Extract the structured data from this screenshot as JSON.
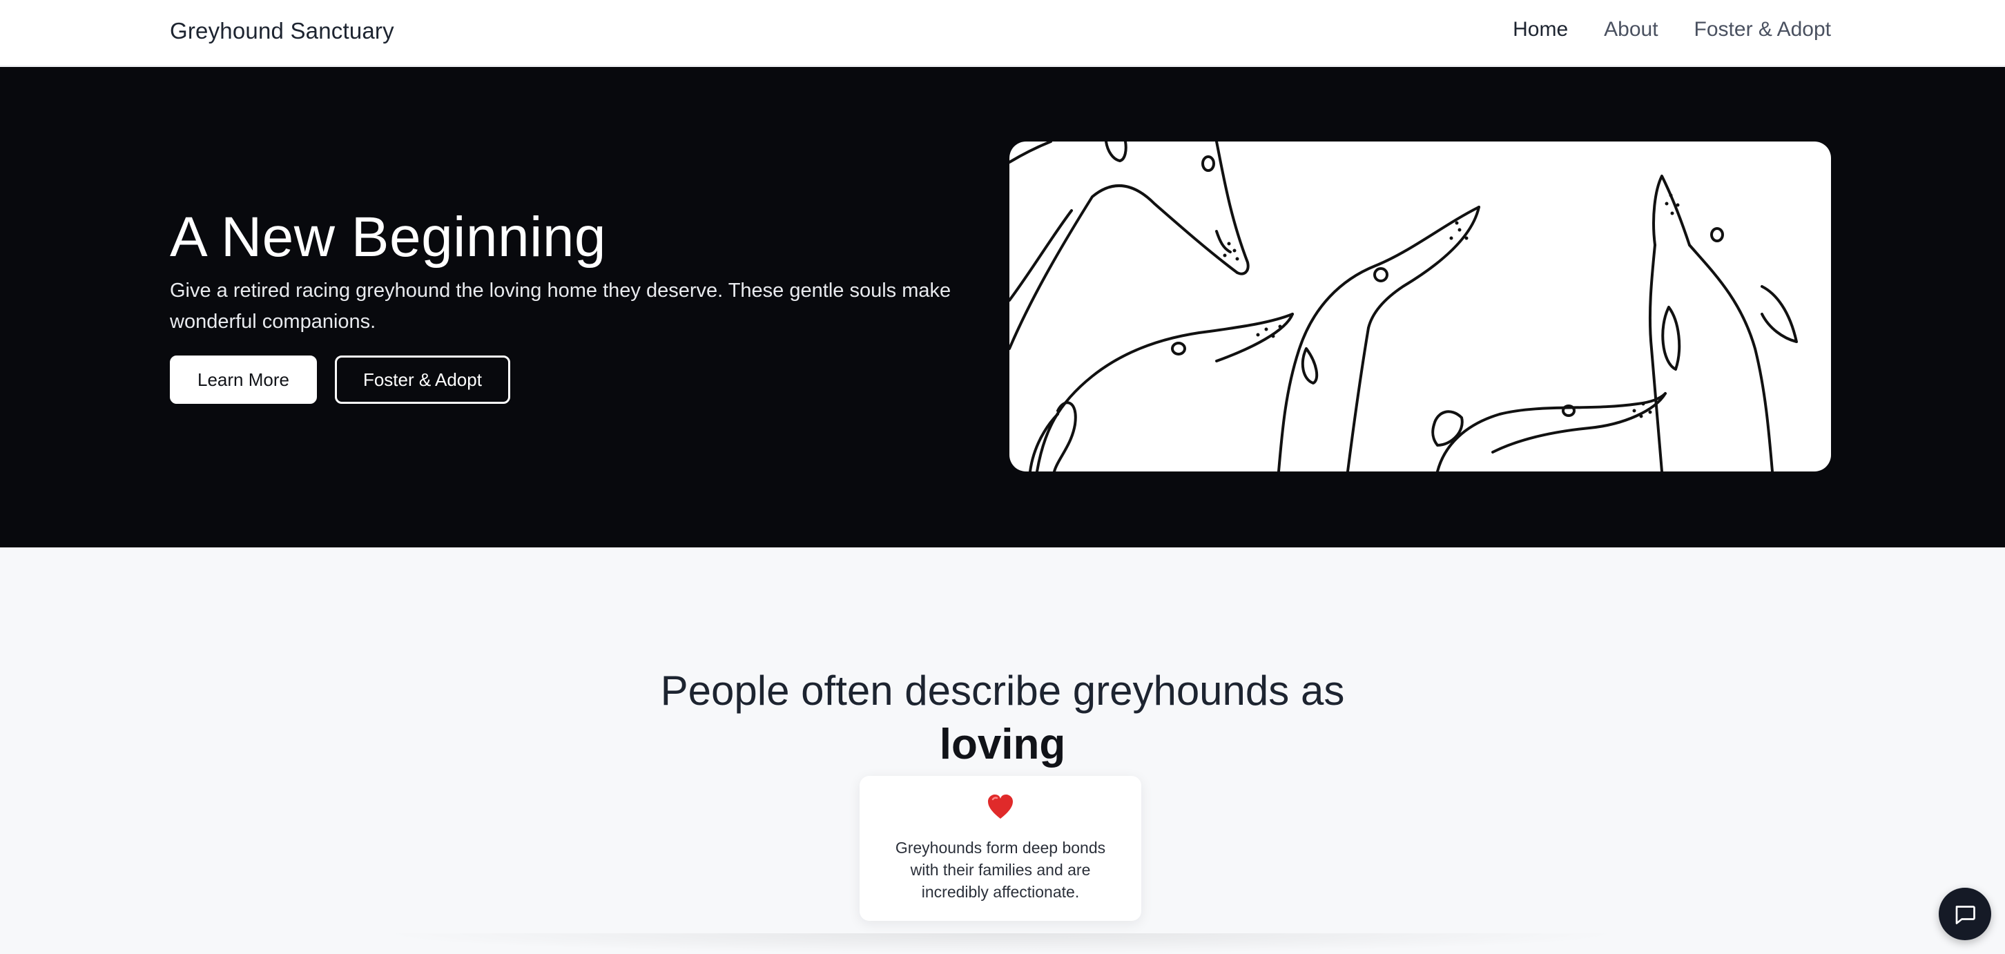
{
  "header": {
    "brand": "Greyhound Sanctuary",
    "nav": [
      {
        "label": "Home",
        "active": true
      },
      {
        "label": "About",
        "active": false
      },
      {
        "label": "Foster & Adopt",
        "active": false
      }
    ]
  },
  "hero": {
    "title": "A New Beginning",
    "subtitle": "Give a retired racing greyhound the loving home they deserve. These gentle souls make wonderful companions.",
    "primary_button": "Learn More",
    "secondary_button": "Foster & Adopt",
    "image_icon": "greyhound-sketch-illustration"
  },
  "describe": {
    "heading": "People often describe greyhounds as",
    "word": "loving",
    "card": {
      "icon": "heart-icon",
      "text": "Greyhounds form deep bonds with their families and are incredibly affectionate."
    }
  },
  "chat": {
    "icon": "chat-bubble-icon"
  },
  "colors": {
    "hero_background": "#08090d",
    "page_background": "#f7f8fa",
    "heart": "#e02a2a",
    "chat_button": "#151a26"
  }
}
